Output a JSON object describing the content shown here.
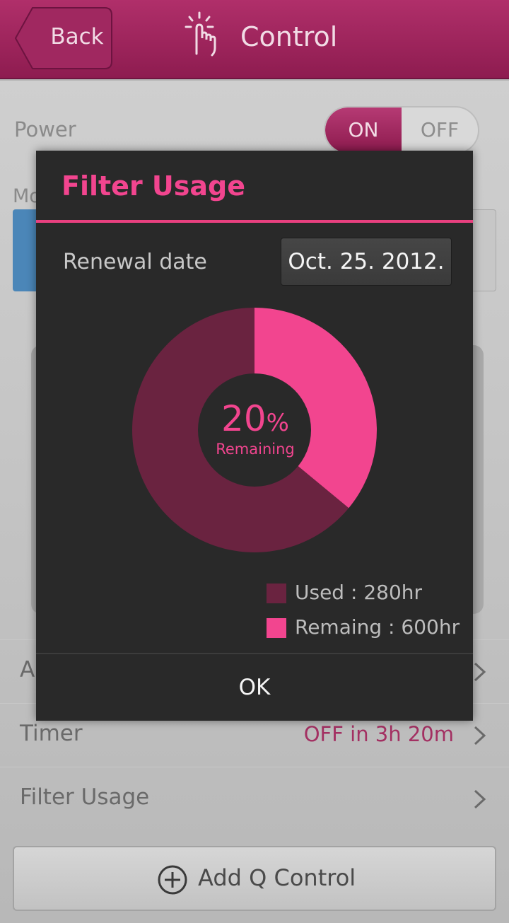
{
  "header": {
    "back_label": "Back",
    "title": "Control",
    "title_icon": "touch-control-icon"
  },
  "background": {
    "power_label": "Power",
    "power_toggle": {
      "on_label": "ON",
      "off_label": "OFF",
      "selected": "ON"
    },
    "mode_label_fragment": "Mo",
    "rows": [
      {
        "label": "A",
        "value": ""
      },
      {
        "label": "Timer",
        "value": "OFF in 3h 20m"
      },
      {
        "label": "Filter Usage",
        "value": ""
      }
    ],
    "add_q_control_label": "Add Q Control",
    "add_q_control_icon": "plus-circle-icon"
  },
  "dialog": {
    "title": "Filter Usage",
    "renewal_label": "Renewal date",
    "renewal_date": "Oct. 25. 2012.",
    "percent_number": "20",
    "percent_sign": "%",
    "percent_caption": "Remaining",
    "ok_label": "OK"
  },
  "colors": {
    "accent": "#f2458f",
    "header": "#9e2459",
    "used": "#6a2340",
    "remaining": "#f2458f",
    "dialog_bg": "#292929"
  },
  "chart_data": {
    "type": "pie",
    "categories": [
      "Used : 280hr",
      "Remaing : 600hr"
    ],
    "values": [
      64,
      36
    ],
    "colors": [
      "#6a2340",
      "#f2458f"
    ],
    "legend_position": "bottom-right",
    "center_text": "20% Remaining"
  }
}
